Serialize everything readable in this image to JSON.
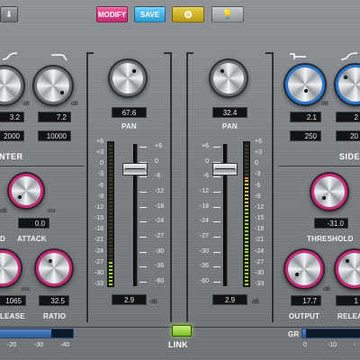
{
  "toolbar": {
    "modify_label": "MODIFY",
    "save_label": "SAVE",
    "gear_icon": "⚙",
    "bulb_icon": "💡",
    "left_icon": "⬇",
    "colors": {
      "modify": "#e0408a",
      "save": "#3fb0ec",
      "gear": "#d6bb2c",
      "bulb": "#aeb1b4"
    }
  },
  "left_panel": {
    "eq_values": [
      "3.2",
      "7.2",
      "2000",
      "10000"
    ],
    "eq_units": [
      "dB",
      "dB"
    ],
    "section_label": "NTER",
    "mid_knob_units": [
      "dB",
      "ms"
    ],
    "attack_value": "0.0",
    "labels_row1": [
      "D",
      "ATTACK"
    ],
    "release_value": "1065",
    "ratio_value": "32.5",
    "release_unit": "ms",
    "labels_row2": [
      "LEASE",
      "RATIO"
    ]
  },
  "center_left": {
    "pan_value": "67.6",
    "pan_label": "PAN",
    "scale_left": [
      "+6",
      "+3",
      "0",
      "-3",
      "-6",
      "-9",
      "-12",
      "-15",
      "-18",
      "-21",
      "-24",
      "-27",
      "-30",
      "-33"
    ],
    "scale_right": [
      "+6",
      "0",
      "-6",
      "-12",
      "-18",
      "-24",
      "-27",
      "-30",
      "-36",
      "-60"
    ],
    "fader_value": "2.9",
    "fader_unit": "dB",
    "meter_level": 0.17
  },
  "center_right": {
    "pan_value": "32.4",
    "pan_label": "PAN",
    "scale_left": [
      "+6",
      "0",
      "-6",
      "-12",
      "-18",
      "-24",
      "-27",
      "-30",
      "-36",
      "-60"
    ],
    "scale_right": [
      "+6",
      "+3",
      "0",
      "-3",
      "-6",
      "-9",
      "-12",
      "-15",
      "-18",
      "-21",
      "-24",
      "-27",
      "-30",
      "-33"
    ],
    "fader_value": "2.9",
    "fader_unit": "dB",
    "meter_level": 0.78
  },
  "right_panel": {
    "eq_values": [
      "2.1",
      "2",
      "250",
      "20"
    ],
    "eq_units": [
      "dB",
      "dB"
    ],
    "section_label": "SIDE",
    "threshold_value": "-31.0",
    "threshold_label": "THRESHOLD",
    "output_value": "17.7",
    "output_label": "OUTPUT",
    "release_value": "1",
    "release_label": "RELEA",
    "unit_db": "dB"
  },
  "bottom": {
    "link_label": "LINK",
    "left_gr_ticks": [
      "-20",
      "-30",
      "-40"
    ],
    "gr_label": "GR",
    "right_gr_ticks": [
      "0",
      "-10",
      "-"
    ],
    "colors": {
      "gr_fill": "#3a72b6",
      "link_led": "#9fd63a"
    }
  }
}
